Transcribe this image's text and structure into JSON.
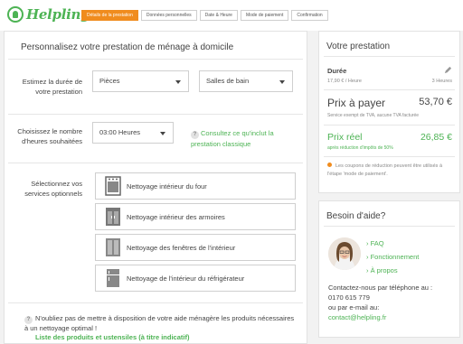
{
  "header": {
    "logo_text": "Helpling",
    "steps": [
      {
        "label": "Détails de la prestation",
        "active": true
      },
      {
        "label": "Données personnelles",
        "active": false
      },
      {
        "label": "Date & Heure",
        "active": false
      },
      {
        "label": "Mode de paiement",
        "active": false
      },
      {
        "label": "Confirmation",
        "active": false
      }
    ]
  },
  "main": {
    "title": "Personnalisez votre prestation de ménage à domicile",
    "duration": {
      "label": "Estimez la durée de votre prestation",
      "rooms_select": "Pièces",
      "bathroom_select": "Salles de bain"
    },
    "hours": {
      "label": "Choisissez le nombre d'heures souhaitées",
      "select_value": "03:00 Heures",
      "consult_link": "Consultez ce qu'inclut la prestation classique"
    },
    "services": {
      "label": "Sélectionnez vos services optionnels",
      "items": [
        {
          "label": "Nettoyage intérieur du four",
          "icon": "oven-icon"
        },
        {
          "label": "Nettoyage intérieur des armoires",
          "icon": "cupboard-icon"
        },
        {
          "label": "Nettoyage des fenêtres de l'intérieur",
          "icon": "window-icon"
        },
        {
          "label": "Nettoyage de l'intérieur du réfrigérateur",
          "icon": "fridge-icon"
        }
      ]
    },
    "note": {
      "text": "N'oubliez pas de mettre à disposition de votre aide ménagère les produits nécessaires à un nettoyage optimal !",
      "link": "Liste des produits et ustensiles (à titre indicatif)"
    }
  },
  "summary": {
    "title": "Votre prestation",
    "duree_label": "Durée",
    "rate": "17,90 € / Heure",
    "hours": "3 Heures",
    "pay_label": "Prix à payer",
    "pay_value": "53,70 €",
    "tva_note": "Service exempt de TVA, aucune TVA facturée",
    "reel_label": "Prix réel",
    "reel_value": "26,85 €",
    "reduc_note": "après réduction d'impôts de 50%",
    "coupon_note": "Les coupons de réduction peuvent être utilisés à l'étape 'mode de paiement'."
  },
  "help": {
    "title": "Besoin d'aide?",
    "links": [
      "› FAQ",
      "› Fonctionnement",
      "› À propos"
    ],
    "contact_phone_label": "Contactez-nous par téléphone au :",
    "phone": "0170 615 779",
    "email_label": "ou par e-mail au:",
    "email": "contact@helpling.fr"
  },
  "colors": {
    "brand_green": "#4db354",
    "accent_orange": "#f08c1e"
  }
}
